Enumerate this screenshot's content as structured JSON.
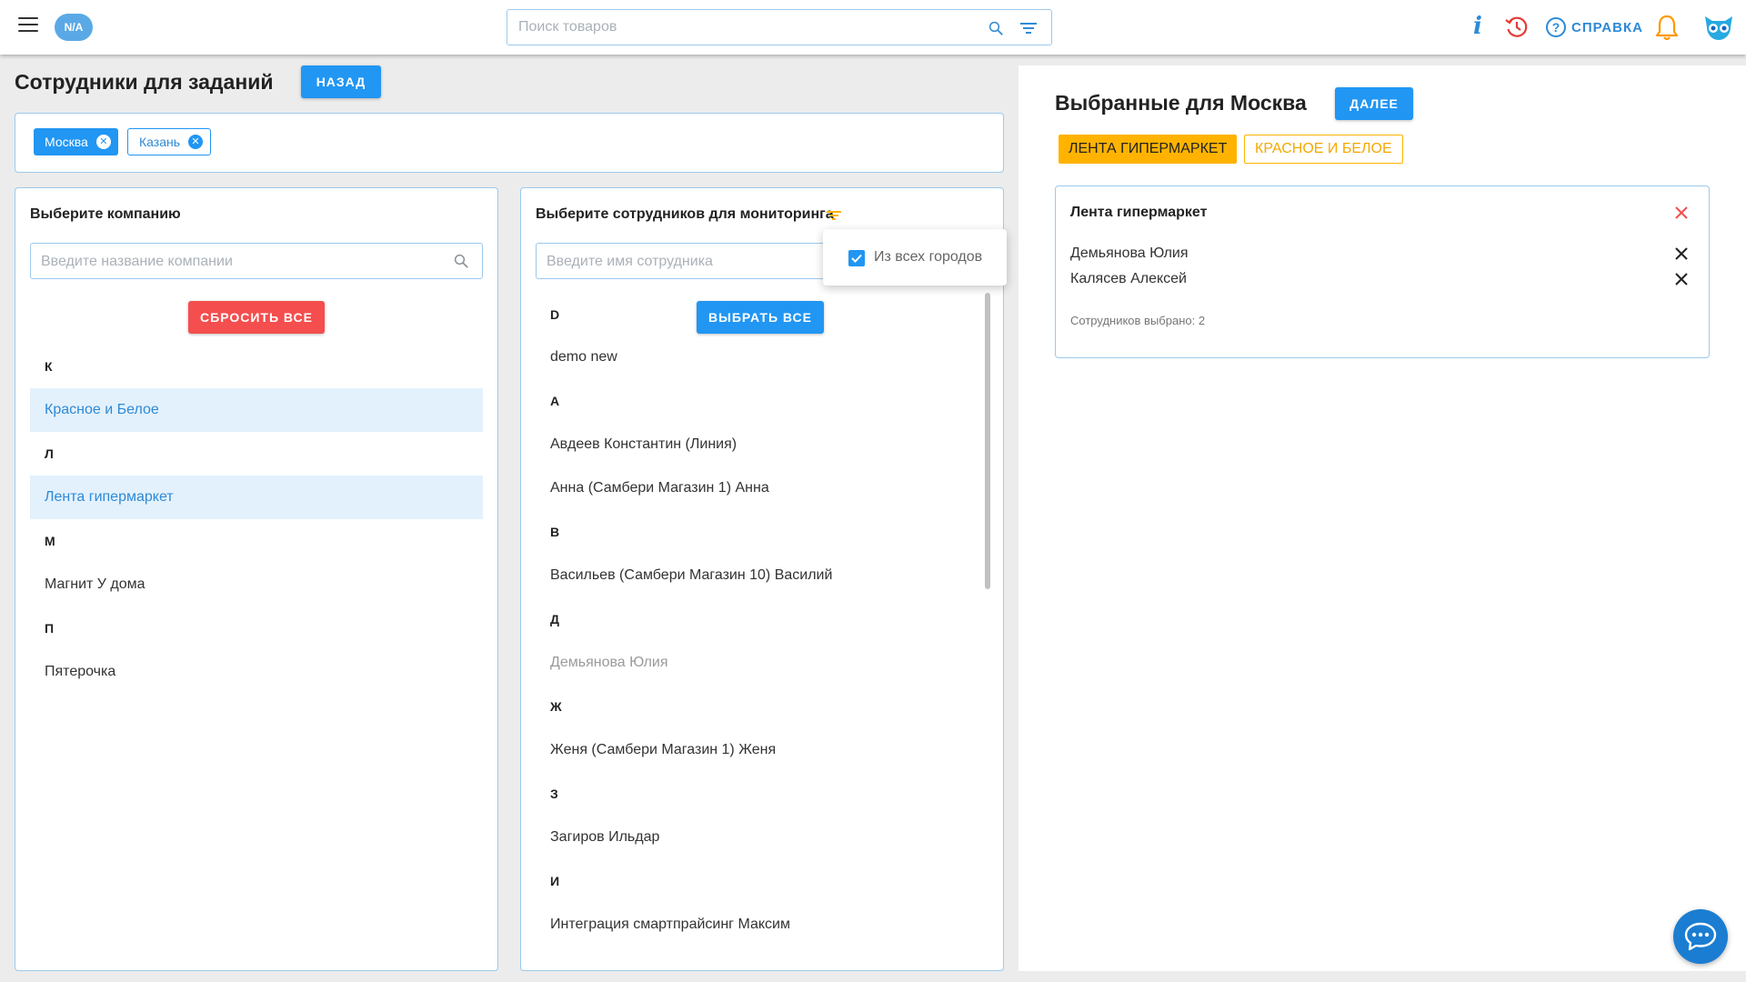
{
  "topbar": {
    "avatar_label": "N/A",
    "search_placeholder": "Поиск товаров",
    "info_label": "i",
    "help_label": "СПРАВКА",
    "help_q": "?"
  },
  "page": {
    "title": "Сотрудники для заданий",
    "back_label": "НАЗАД"
  },
  "cities": {
    "items": [
      {
        "label": "Москва",
        "active": true
      },
      {
        "label": "Казань",
        "active": false
      }
    ],
    "remove_glyph": "✕"
  },
  "companies": {
    "heading": "Выберите компанию",
    "search_placeholder": "Введите название компании",
    "reset_label": "СБРОСИТЬ ВСЕ",
    "groups": [
      {
        "letter": "К",
        "items": [
          {
            "name": "Красное и Белое",
            "selected": true
          }
        ]
      },
      {
        "letter": "Л",
        "items": [
          {
            "name": "Лента гипермаркет",
            "selected": true
          }
        ]
      },
      {
        "letter": "М",
        "items": [
          {
            "name": "Магнит У дома",
            "selected": false
          }
        ]
      },
      {
        "letter": "П",
        "items": [
          {
            "name": "Пятерочка",
            "selected": false
          }
        ]
      }
    ]
  },
  "employees": {
    "heading": "Выберите сотрудников для мониторинга",
    "search_placeholder": "Введите имя сотрудника",
    "select_all_label": "ВЫБРАТЬ ВСЕ",
    "filter_popover": {
      "label": "Из всех городов",
      "checked": true
    },
    "groups": [
      {
        "letter": "D",
        "items": [
          {
            "name": "demo new",
            "dim": false
          }
        ]
      },
      {
        "letter": "А",
        "items": [
          {
            "name": "Авдеев Константин (Линия)",
            "dim": false
          },
          {
            "name": "Анна (Самбери Магазин 1) Анна",
            "dim": false
          }
        ]
      },
      {
        "letter": "В",
        "items": [
          {
            "name": "Васильев (Самбери Магазин 10) Василий",
            "dim": false
          }
        ]
      },
      {
        "letter": "Д",
        "items": [
          {
            "name": "Демьянова Юлия",
            "dim": true
          }
        ]
      },
      {
        "letter": "Ж",
        "items": [
          {
            "name": "Женя (Самбери Магазин 1) Женя",
            "dim": false
          }
        ]
      },
      {
        "letter": "З",
        "items": [
          {
            "name": "Загиров Ильдар",
            "dim": false
          }
        ]
      },
      {
        "letter": "И",
        "items": [
          {
            "name": "Интеграция смартпрайсинг Максим",
            "dim": false
          }
        ]
      }
    ]
  },
  "selected": {
    "title": "Выбранные для Москва",
    "next_label": "ДАЛЕЕ",
    "tabs": [
      {
        "label": "ЛЕНТА ГИПЕРМАРКЕТ",
        "active": true
      },
      {
        "label": "КРАСНОЕ И БЕЛОЕ",
        "active": false
      }
    ],
    "card": {
      "company": "Лента гипермаркет",
      "employees": [
        "Демьянова Юлия",
        "Калясев Алексей"
      ],
      "count_text": "Сотрудников выбрано: 2"
    }
  },
  "colors": {
    "primary": "#2196f3",
    "danger": "#f44e4e",
    "accent": "#ffb300",
    "selected_bg": "#e3f1fd",
    "chat": "#1b7dd1"
  }
}
